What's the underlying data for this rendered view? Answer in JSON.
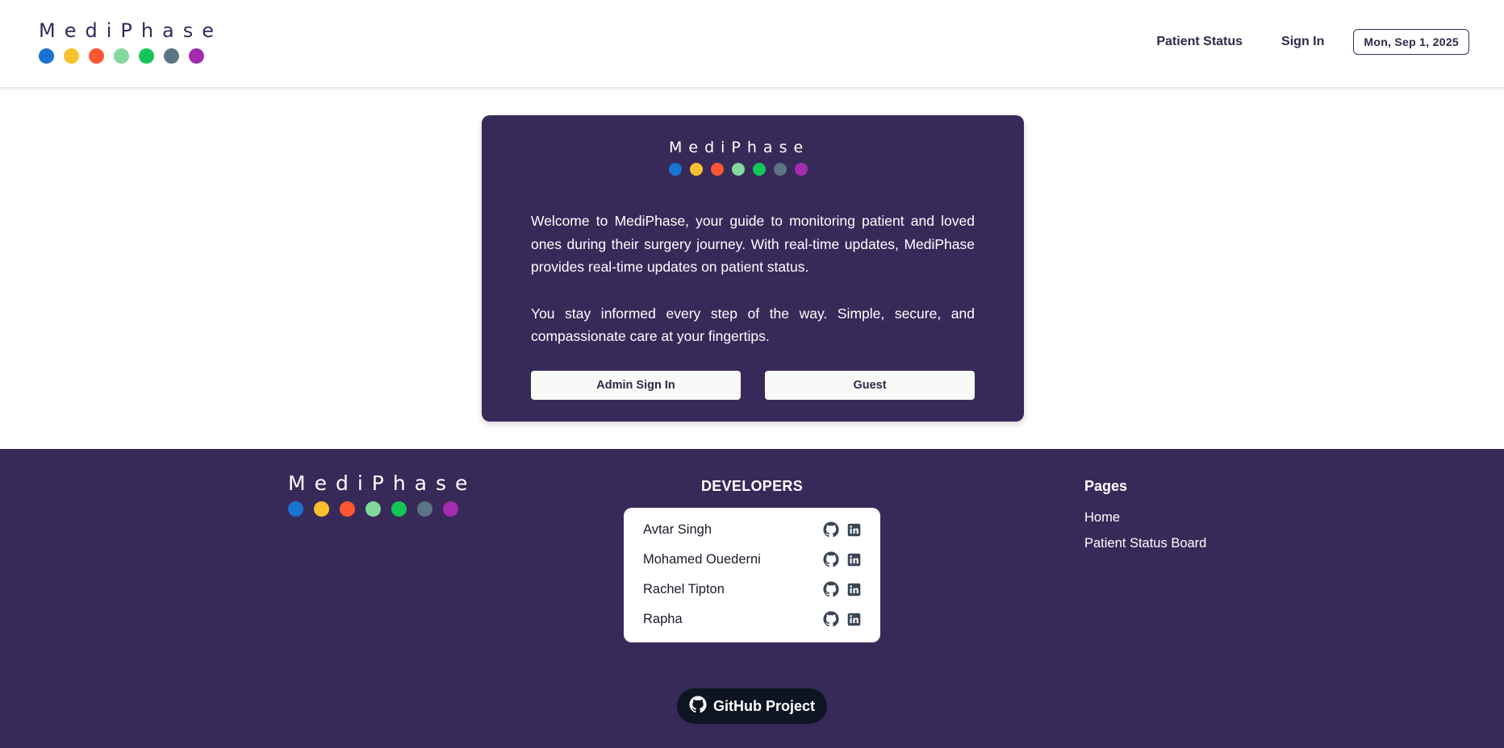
{
  "brand": {
    "name": "MediPhase",
    "dot_colors": [
      "#1a73d0",
      "#fbc02d",
      "#ff5733",
      "#81d99b",
      "#15c55a",
      "#5c7583",
      "#a42cb0"
    ]
  },
  "header": {
    "nav": {
      "patient_status": "Patient Status",
      "sign_in": "Sign In"
    },
    "date": "Mon, Sep 1, 2025"
  },
  "card": {
    "paragraph_1": "Welcome to MediPhase, your guide to monitoring patient and loved ones during their surgery journey. With real-time updates, MediPhase provides real-time updates on patient status.",
    "paragraph_2": "You stay informed every step of the way. Simple, secure, and compassionate care at your fingertips.",
    "admin_button": "Admin Sign In",
    "guest_button": "Guest"
  },
  "footer": {
    "developers_title": "DEVELOPERS",
    "developers": [
      {
        "name": "Avtar Singh",
        "icons": [
          "github-icon",
          "linkedin-icon"
        ]
      },
      {
        "name": "Mohamed Ouederni",
        "icons": [
          "github-icon",
          "linkedin-icon"
        ]
      },
      {
        "name": "Rachel Tipton",
        "icons": [
          "github-icon",
          "linkedin-icon"
        ]
      },
      {
        "name": "Rapha",
        "icons": [
          "github-icon",
          "linkedin-icon"
        ]
      }
    ],
    "pages_title": "Pages",
    "pages": [
      "Home",
      "Patient Status Board"
    ],
    "github_button": "GitHub Project"
  }
}
